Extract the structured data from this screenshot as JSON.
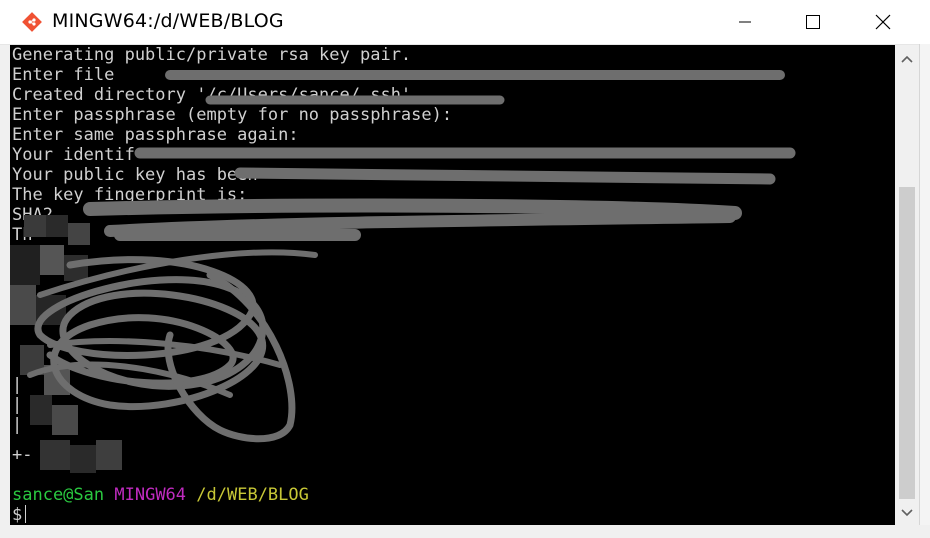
{
  "window": {
    "title": "MINGW64:/d/WEB/BLOG",
    "controls": {
      "minimize": "minimize-icon",
      "maximize": "maximize-icon",
      "close": "close-icon"
    }
  },
  "terminal": {
    "lines": [
      "Generating public/private rsa key pair.",
      "Enter file ",
      "Created directory '/c/Users/sance/.ssh'.",
      "Enter passphrase (empty for no passphrase):",
      "Enter same passphrase again:",
      "Your identif",
      "Your public key has been",
      "The key fingerprint is:",
      "SHA2",
      "Th"
    ],
    "art_fragments": [
      "|",
      "|",
      "|",
      "+-"
    ],
    "prompt": {
      "user": "sance@San",
      "env": "MINGW64",
      "path": "/d/WEB/BLOG",
      "symbol": "$"
    }
  },
  "colors": {
    "background": "#000000",
    "text": "#d0d0d0",
    "user": "#2ac940",
    "env": "#c02bc0",
    "path": "#c7c736",
    "redaction": "#6e6e6e"
  }
}
